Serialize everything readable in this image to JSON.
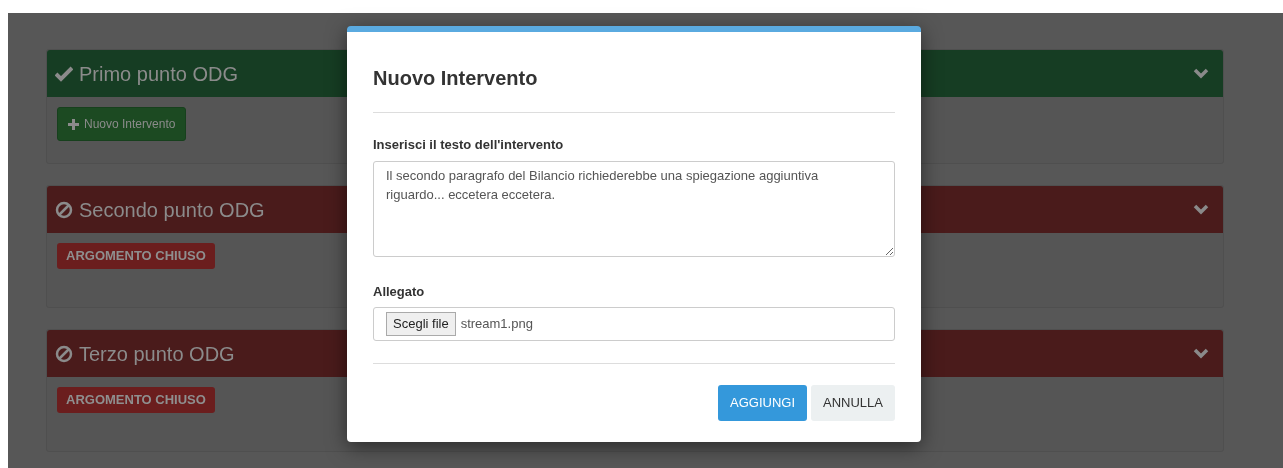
{
  "agenda_items": [
    {
      "title": "Primo punto ODG",
      "kind": "open",
      "action": {
        "kind": "button",
        "label": "Nuovo Intervento"
      }
    },
    {
      "title": "Secondo punto ODG",
      "kind": "closed",
      "action": {
        "kind": "badge",
        "label": "ARGOMENTO CHIUSO"
      }
    },
    {
      "title": "Terzo punto ODG",
      "kind": "closed",
      "action": {
        "kind": "badge",
        "label": "ARGOMENTO CHIUSO"
      }
    }
  ],
  "modal": {
    "title": "Nuovo Intervento",
    "text_label": "Inserisci il testo dell'intervento",
    "text_value": "Il secondo paragrafo del Bilancio richiederebbe una spiegazione aggiuntiva riguardo... eccetera eccetera.",
    "attachment_label": "Allegato",
    "file_button": "Scegli file",
    "file_name": "stream1.png",
    "buttons": [
      {
        "label": "AGGIUNGI",
        "kind": "primary"
      },
      {
        "label": "ANNULLA",
        "kind": "secondary"
      }
    ]
  }
}
